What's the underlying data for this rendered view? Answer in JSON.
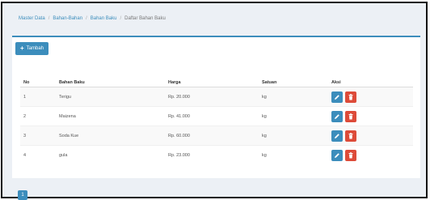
{
  "breadcrumb": {
    "items": [
      "Master Data",
      "Bahan-Bahan",
      "Bahan Baku"
    ],
    "current": "Daftar Bahan Baku"
  },
  "toolbar": {
    "add_label": "Tambah"
  },
  "table": {
    "headers": {
      "no": "No",
      "bahan": "Bahan Baku",
      "harga": "Harga",
      "satuan": "Satuan",
      "aksi": "Aksi"
    },
    "rows": [
      {
        "no": "1",
        "bahan": "Terigu",
        "harga": "Rp. 20.000",
        "satuan": "kg"
      },
      {
        "no": "2",
        "bahan": "Maizena",
        "harga": "Rp. 41.000",
        "satuan": "kg"
      },
      {
        "no": "3",
        "bahan": "Soda Kue",
        "harga": "Rp. 60.000",
        "satuan": "kg"
      },
      {
        "no": "4",
        "bahan": "gula",
        "harga": "Rp. 23.000",
        "satuan": "kg"
      }
    ]
  },
  "pagination": {
    "current_page": "1"
  },
  "icons": {
    "add": "plus-icon",
    "edit": "pencil-icon",
    "delete": "trash-icon"
  },
  "colors": {
    "primary": "#3c8dbc",
    "danger": "#dd4b39",
    "background": "#ecf0f5"
  }
}
